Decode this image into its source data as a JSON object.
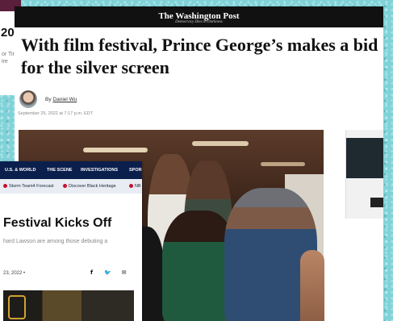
{
  "card_topleft": {
    "big_text": "20",
    "small_text": "or Tin\nire"
  },
  "wapo": {
    "masthead": "The Washington Post",
    "tagline": "Democracy Dies in Darkness",
    "headline": "With film festival, Prince George’s makes a bid for the silver screen",
    "byline_prefix": "By",
    "author": "Daniel Wu",
    "dateline": "September 25, 2022 at 7:17 p.m. EDT"
  },
  "news_card": {
    "nav": [
      "U.S. & WORLD",
      "THE SCENE",
      "INVESTIGATIONS",
      "SPOR"
    ],
    "subnav": [
      "Storm Team4 Forecast",
      "Discover Black Heritage",
      "NB"
    ],
    "headline": "Festival Kicks Off",
    "dek": "hard Lawson are among those debuting a",
    "date": "23, 2022 •",
    "share_icons": [
      "facebook-icon",
      "twitter-icon",
      "email-icon"
    ]
  },
  "colors": {
    "background": "#7fd3d8",
    "wapo_bar": "#111111",
    "nav": "#0b1f4d"
  }
}
